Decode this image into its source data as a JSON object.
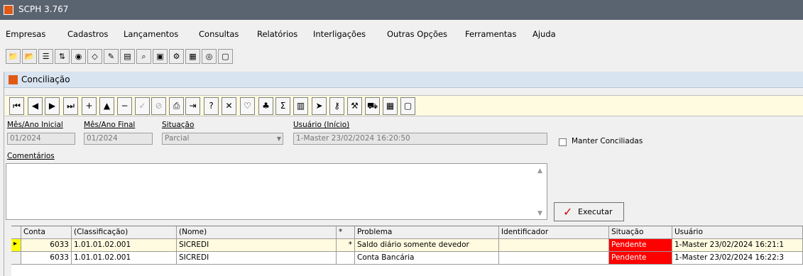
{
  "window": {
    "title": "SCPH 3.767"
  },
  "menu": [
    "Empresas",
    "Cadastros",
    "Lançamentos",
    "Consultas",
    "Relatórios",
    "Interligações",
    "Outras Opções",
    "Ferramentas",
    "Ajuda"
  ],
  "form": {
    "title": "Conciliação",
    "fields": {
      "mes_inicial": {
        "label": "Mês/Ano Inicial",
        "value": "01/2024"
      },
      "mes_final": {
        "label": "Mês/Ano Final",
        "value": "01/2024"
      },
      "situacao": {
        "label": "Situação",
        "value": "Parcial"
      },
      "usuario": {
        "label": "Usuário (Início)",
        "value": "1-Master 23/02/2024 16:20:50"
      },
      "manter": {
        "label": "Manter Conciliadas",
        "checked": false
      },
      "comentarios": {
        "label": "Comentários",
        "value": ""
      }
    },
    "executar_label": "Executar"
  },
  "grid": {
    "headers": {
      "conta": "Conta",
      "classificacao": "(Classificação)",
      "nome": "(Nome)",
      "star": "*",
      "problema": "Problema",
      "identificador": "Identificador",
      "situacao": "Situação",
      "usuario": "Usuário"
    },
    "rows": [
      {
        "conta": "6033",
        "classificacao": "1.01.01.02.001",
        "nome": "SICREDI",
        "star": "*",
        "problema": "Saldo diário somente devedor",
        "identificador": "",
        "situacao": "Pendente",
        "usuario": "1-Master 23/02/2024 16:21:1"
      },
      {
        "conta": "6033",
        "classificacao": "1.01.01.02.001",
        "nome": "SICREDI",
        "star": "",
        "problema": "Conta Bancária",
        "identificador": "",
        "situacao": "Pendente",
        "usuario": "1-Master 23/02/2024 16:22:3"
      }
    ]
  },
  "colors": {
    "title_bar": "#5a6470",
    "form_title_bg": "#d9e4f1",
    "nav_bg": "#fffbe0",
    "status_pending": "#ff0000"
  }
}
